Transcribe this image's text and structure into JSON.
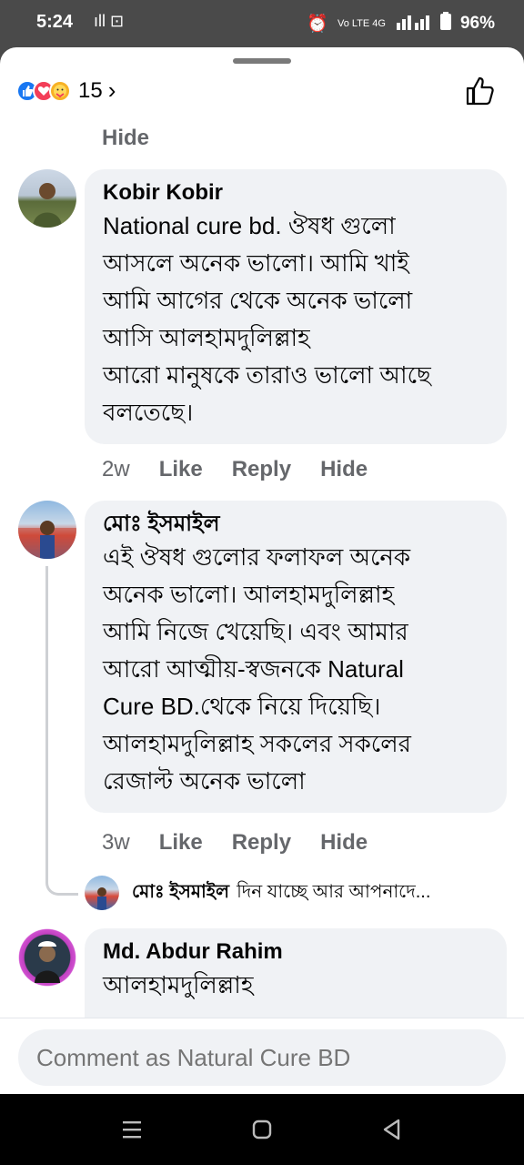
{
  "status_bar": {
    "time": "5:24",
    "left_icons": "ıll ⊡",
    "network": "Vo LTE 4G",
    "battery": "96%"
  },
  "reactions": {
    "count": "15",
    "chevron": "›"
  },
  "top_hide_label": "Hide",
  "comments": [
    {
      "name": "Kobir Kobir",
      "text": "National cure bd. ঔষধ গুলো\nআসলে অনেক ভালো। আমি খাই\nআমি আগের থেকে অনেক  ভালো\nআসি আলহামদুলিল্লাহ\nআরো মানুষকে তারাও ভালো আছে\nবলতেছে।",
      "age": "2w",
      "like": "Like",
      "reply": "Reply",
      "hide": "Hide"
    },
    {
      "name": "মোঃ ইসমাইল",
      "text": "এই ঔষধ গুলোর ফলাফল অনেক\nঅনেক ভালো। আলহামদুলিল্লাহ\nআমি নিজে খেয়েছি। এবং আমার\nআরো  আত্মীয়-স্বজনকে  Natural\nCure BD.থেকে  নিয়ে দিয়েছি।\nআলহামদুলিল্লাহ সকলের সকলের\nরেজাল্ট অনেক  ভালো",
      "age": "3w",
      "like": "Like",
      "reply": "Reply",
      "hide": "Hide"
    },
    {
      "name": "Md. Abdur Rahim",
      "text": "আলহামদুলিল্লাহ"
    }
  ],
  "reply_preview": {
    "name": "মোঃ ইসমাইল",
    "snippet": "দিন যাচ্ছে আর আপনাদে..."
  },
  "comment_input": {
    "placeholder": "Comment as Natural Cure BD"
  },
  "colors": {
    "like_blue": "#1877f2",
    "love_red": "#f33e58",
    "care_yellow": "#f7b125",
    "bubble_bg": "#f0f2f5",
    "meta_gray": "#65676b"
  }
}
